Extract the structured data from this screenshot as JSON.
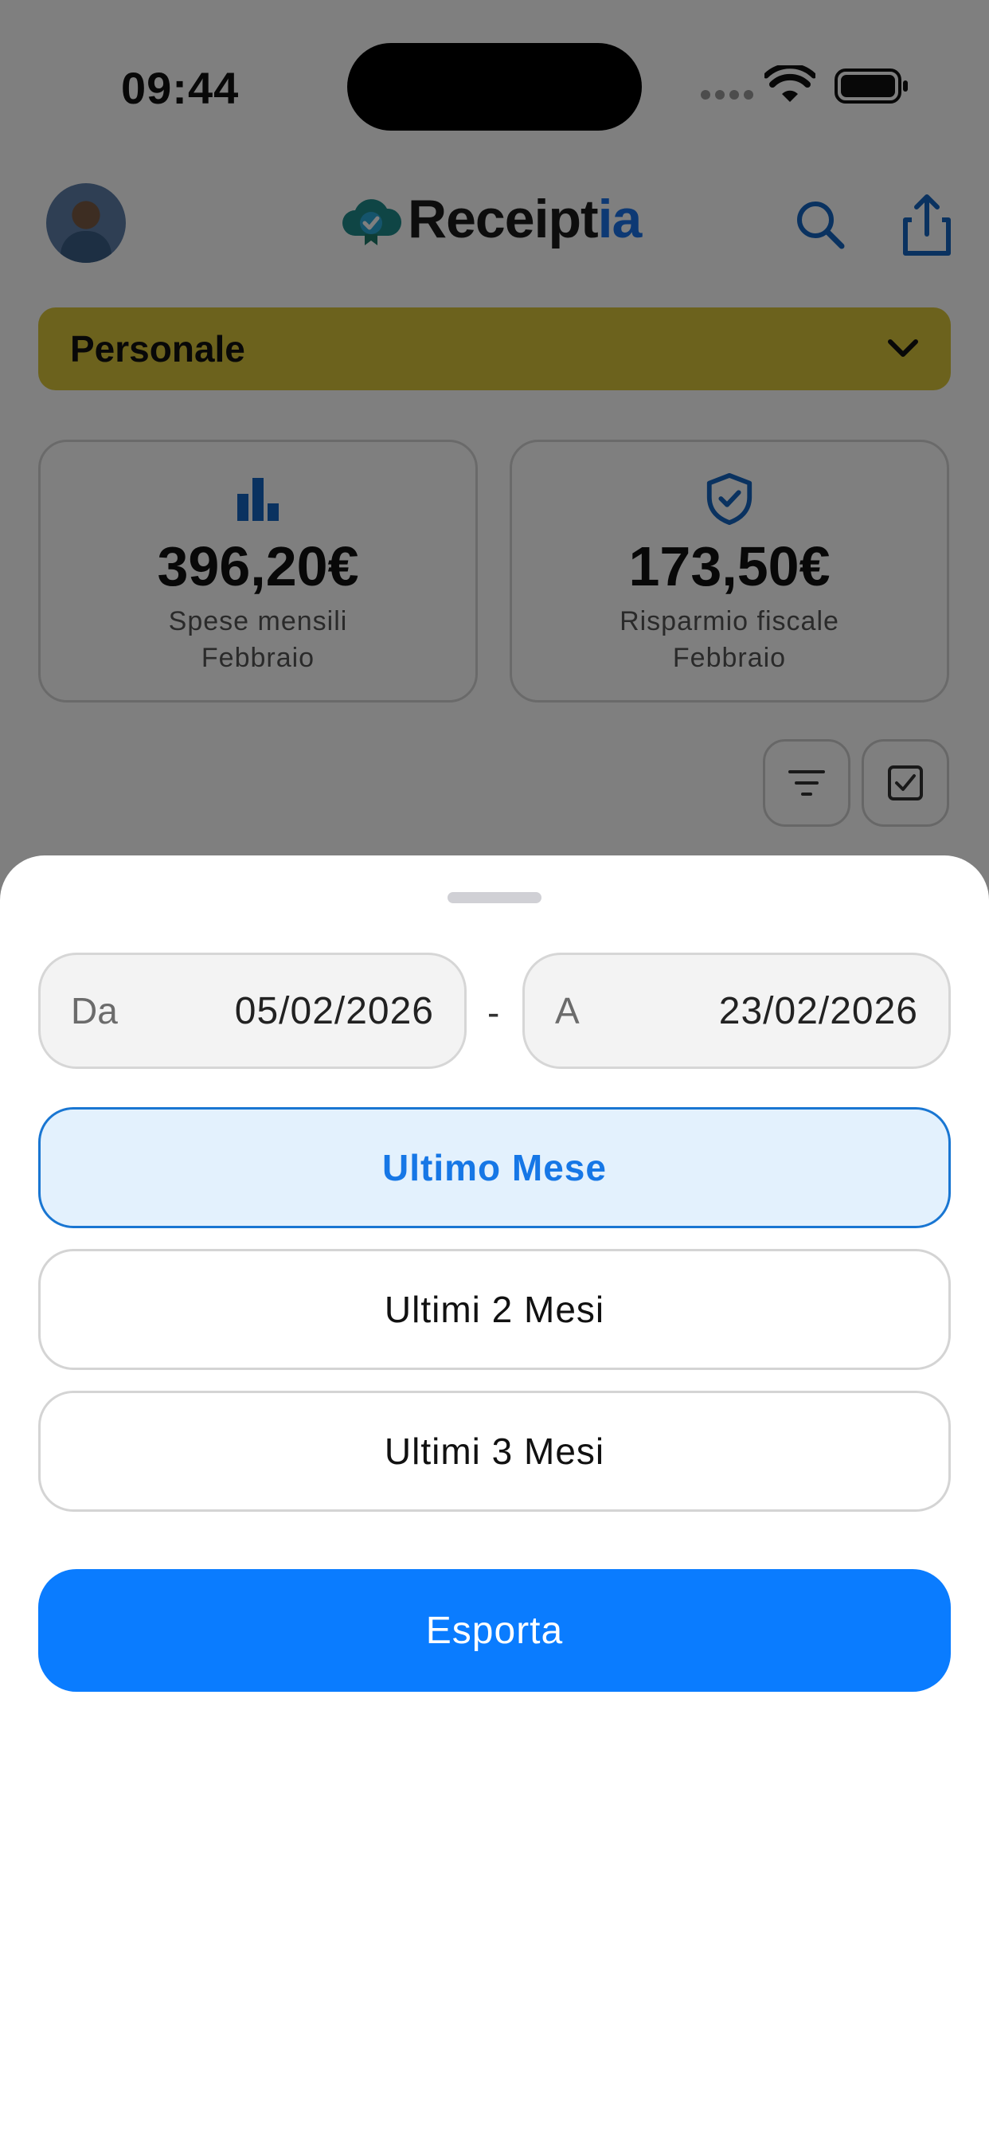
{
  "status_bar": {
    "time": "09:44"
  },
  "header": {
    "brand_main": "Receipt",
    "brand_accent": "ia",
    "search_icon": "search-icon",
    "share_icon": "share-icon"
  },
  "account_selector": {
    "label": "Personale"
  },
  "stats": [
    {
      "amount": "396,20€",
      "label": "Spese mensili",
      "month": "Febbraio",
      "icon": "bar-chart-icon"
    },
    {
      "amount": "173,50€",
      "label": "Risparmio fiscale",
      "month": "Febbraio",
      "icon": "shield-check-icon"
    }
  ],
  "colors": {
    "brand_accent": "#1a73e8",
    "account_bar": "#d8c43b",
    "primary_button": "#0a7cff",
    "selected_option_bg": "#e3f1fd",
    "selected_option_border": "#1976d2"
  },
  "export_sheet": {
    "from_label": "Da",
    "from_value": "05/02/2026",
    "separator": "-",
    "to_label": "A",
    "to_value": "23/02/2026",
    "options": [
      {
        "label": "Ultimo Mese",
        "selected": true
      },
      {
        "label": "Ultimi 2 Mesi",
        "selected": false
      },
      {
        "label": "Ultimi 3 Mesi",
        "selected": false
      }
    ],
    "export_label": "Esporta"
  }
}
